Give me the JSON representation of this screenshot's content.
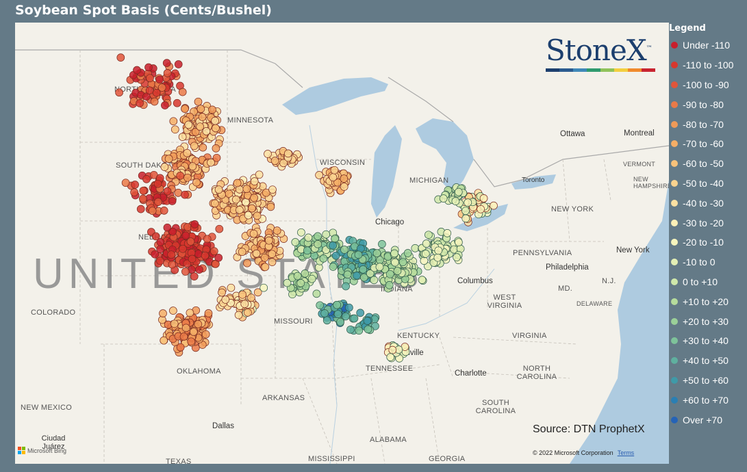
{
  "title": "Soybean Spot Basis (Cents/Bushel)",
  "legend": {
    "title": "Legend",
    "items": [
      {
        "label": "Under -110",
        "color": "#c81e2c"
      },
      {
        "label": "-110 to -100",
        "color": "#d7372e"
      },
      {
        "label": "-100 to -90",
        "color": "#e0553a"
      },
      {
        "label": "-90 to -80",
        "color": "#ea7a48"
      },
      {
        "label": "-80 to -70",
        "color": "#f09a58"
      },
      {
        "label": "-70 to -60",
        "color": "#f5ae66"
      },
      {
        "label": "-60 to -50",
        "color": "#f8c27a"
      },
      {
        "label": "-50 to -40",
        "color": "#fad38f"
      },
      {
        "label": "-40 to -30",
        "color": "#fce1a2"
      },
      {
        "label": "-30 to -20",
        "color": "#fdf0b7"
      },
      {
        "label": "-20 to -10",
        "color": "#f6f5bd"
      },
      {
        "label": "-10 to 0",
        "color": "#e3efb4"
      },
      {
        "label": "0 to +10",
        "color": "#cfe8aa"
      },
      {
        "label": "+10 to +20",
        "color": "#b6dc9c"
      },
      {
        "label": "+20 to +30",
        "color": "#9bd098"
      },
      {
        "label": "+30 to +40",
        "color": "#7ec39a"
      },
      {
        "label": "+40 to +50",
        "color": "#5fb09f"
      },
      {
        "label": "+50 to +60",
        "color": "#3f9aa8"
      },
      {
        "label": "+60 to +70",
        "color": "#2a7fb3"
      },
      {
        "label": "Over +70",
        "color": "#2563b6"
      }
    ]
  },
  "logo": {
    "text": "StoneX",
    "mark": "™",
    "bar_colors": [
      "#1c3f6e",
      "#2b5b8f",
      "#3f88b8",
      "#2f9a6e",
      "#8fc25a",
      "#f3cf3f",
      "#f08a2c",
      "#c8232f"
    ]
  },
  "source": "Source: DTN ProphetX",
  "copyright": "© 2022 Microsoft Corporation",
  "terms": "Terms",
  "bing": "Microsoft Bing",
  "big_label": "UNITED STATES",
  "states": [
    {
      "name": "NORTH DAKOTA"
    },
    {
      "name": "SOUTH DAKOTA"
    },
    {
      "name": "NEBRASKA"
    },
    {
      "name": "COLORADO"
    },
    {
      "name": "MINNESOTA"
    },
    {
      "name": "WISCONSIN"
    },
    {
      "name": "MICHIGAN"
    },
    {
      "name": "MISSOURI"
    },
    {
      "name": "INDIANA"
    },
    {
      "name": "KENTUCKY"
    },
    {
      "name": "TENNESSEE"
    },
    {
      "name": "OKLAHOMA"
    },
    {
      "name": "ARKANSAS"
    },
    {
      "name": "NEW MEXICO"
    },
    {
      "name": "ALABAMA"
    },
    {
      "name": "GEORGIA"
    },
    {
      "name": "MISSISSIPPI"
    },
    {
      "name": "TEXAS"
    },
    {
      "name": "PENNSYLVANIA"
    },
    {
      "name": "WEST VIRGINIA"
    },
    {
      "name": "VIRGINIA"
    },
    {
      "name": "NORTH CAROLINA"
    },
    {
      "name": "SOUTH CAROLINA"
    },
    {
      "name": "NEW YORK"
    },
    {
      "name": "VERMONT"
    },
    {
      "name": "NEW HAMPSHIRE"
    },
    {
      "name": "MD."
    },
    {
      "name": "DELAWARE"
    },
    {
      "name": "N.J."
    }
  ],
  "cities": [
    {
      "name": "Chicago"
    },
    {
      "name": "Columbus"
    },
    {
      "name": "Nashville"
    },
    {
      "name": "Charlotte"
    },
    {
      "name": "Philadelphia"
    },
    {
      "name": "New York"
    },
    {
      "name": "Toronto"
    },
    {
      "name": "Ottawa"
    },
    {
      "name": "Montreal"
    },
    {
      "name": "Dallas"
    },
    {
      "name": "Ciudad Juárez"
    }
  ]
}
